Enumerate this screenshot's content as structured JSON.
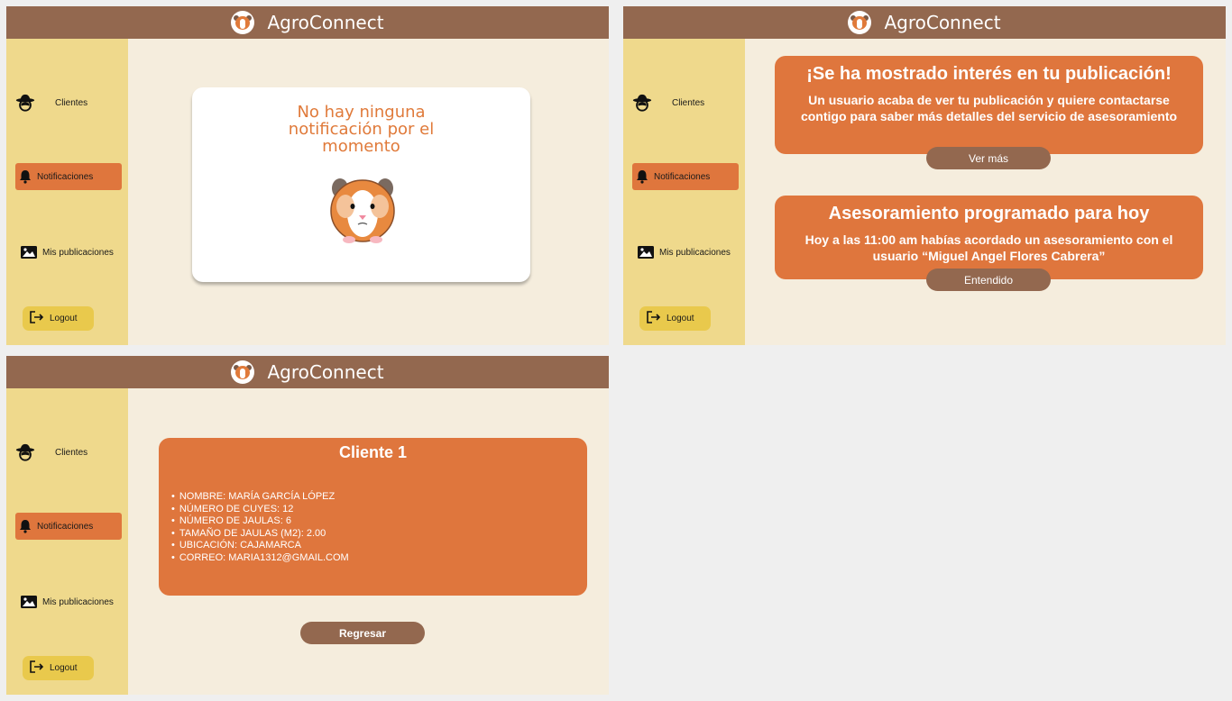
{
  "app": {
    "brand": "AgroConnect"
  },
  "sidebar": {
    "items": [
      {
        "label": "Clientes",
        "icon": "cowboy-hat-icon"
      },
      {
        "label": "Notificaciones",
        "icon": "bell-icon"
      },
      {
        "label": "Mis publicaciones",
        "icon": "image-icon"
      }
    ],
    "logout_label": "Logout"
  },
  "screen_empty": {
    "message": "No hay ninguna notificación por el momento"
  },
  "screen_notifications": {
    "cards": [
      {
        "title": "¡Se ha mostrado interés en tu publicación!",
        "body": "Un usuario acaba de ver tu publicación y quiere contactarse contigo para saber más detalles del servicio de asesoramiento",
        "button": "Ver más"
      },
      {
        "title": "Asesoramiento programado para hoy",
        "body": "Hoy a las 11:00 am habías acordado un asesoramiento con el usuario “Miguel Angel Flores Cabrera”",
        "button": "Entendido"
      }
    ]
  },
  "screen_client": {
    "title": "Cliente 1",
    "details": [
      "NOMBRE: MARÍA GARCÍA LÓPEZ",
      "NÚMERO DE CUYES: 12",
      "NÚMERO DE JAULAS: 6",
      "TAMAÑO DE JAULAS (M2): 2.00",
      "UBICACIÓN: CAJAMARCA",
      "CORREO: MARIA1312@GMAIL.COM"
    ],
    "back_button": "Regresar"
  },
  "colors": {
    "header": "#93684f",
    "sidebar": "#efd98c",
    "content_bg": "#f5eddd",
    "accent": "#df763d",
    "logout": "#e9c94c"
  }
}
